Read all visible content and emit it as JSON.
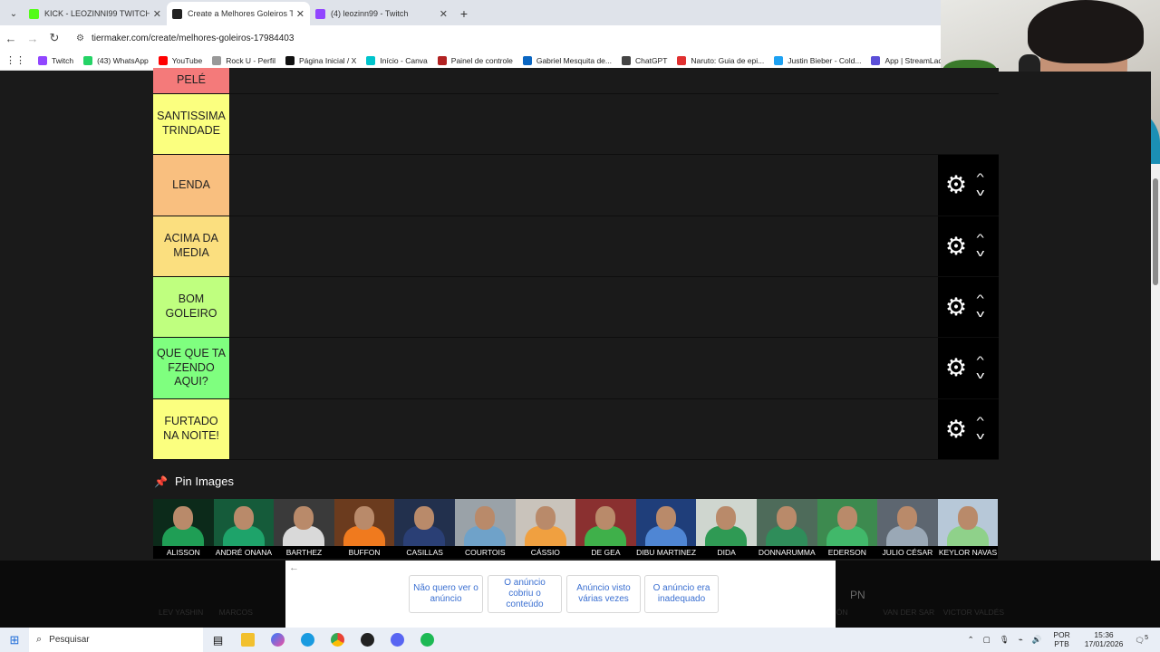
{
  "browser": {
    "tabs": [
      {
        "title": "KICK - LEOZINNI99 TWITCH - LIVE",
        "fav_color": "#53fc18",
        "active": false
      },
      {
        "title": "Create a Melhores Goleiros Tier",
        "fav_color": "#222222",
        "active": true
      },
      {
        "title": "(4) leozinn99 - Twitch",
        "fav_color": "#9146ff",
        "active": false
      }
    ],
    "url": "tiermaker.com/create/melhores-goleiros-17984403",
    "bookmarks": [
      {
        "label": "Twitch",
        "color": "#9146ff"
      },
      {
        "label": "(43) WhatsApp",
        "color": "#25d366"
      },
      {
        "label": "YouTube",
        "color": "#ff0000"
      },
      {
        "label": "Rock U - Perfil",
        "color": "#999999"
      },
      {
        "label": "Página Inicial / X",
        "color": "#111111"
      },
      {
        "label": "Início - Canva",
        "color": "#00c4cc"
      },
      {
        "label": "Painel de controle",
        "color": "#b22222"
      },
      {
        "label": "Gabriel Mesquita de...",
        "color": "#0a66c2"
      },
      {
        "label": "ChatGPT",
        "color": "#444444"
      },
      {
        "label": "Naruto: Guia de epi...",
        "color": "#e03030"
      },
      {
        "label": "Justin Bieber - Cold...",
        "color": "#1da1f2"
      },
      {
        "label": "App | StreamLadder",
        "color": "#5b4fd8"
      },
      {
        "label": "Agend",
        "color": "#2e9e4f"
      }
    ]
  },
  "tiers": [
    {
      "label": "PELÉ",
      "color": "#f47a7a"
    },
    {
      "label": "SANTISSIMA TRINDADE",
      "color": "#fbff7f"
    },
    {
      "label": "LENDA",
      "color": "#f9bf7f"
    },
    {
      "label": "ACIMA DA MEDIA",
      "color": "#fbdf7f"
    },
    {
      "label": "BOM GOLEIRO",
      "color": "#bfff7f"
    },
    {
      "label": "QUE QUE TA FZENDO AQUI?",
      "color": "#7fff7f"
    },
    {
      "label": "FURTADO NA NOITE!",
      "color": "#fbff7f"
    }
  ],
  "pin_images_label": "Pin Images",
  "pool": [
    {
      "name": "ALISSON",
      "kit": "#1f9e55",
      "bg": "#0c2a1a"
    },
    {
      "name": "ANDRÉ ONANA",
      "kit": "#1ea36a",
      "bg": "#155b3a"
    },
    {
      "name": "BARTHEZ",
      "kit": "#d9d9d9",
      "bg": "#3a3a3a"
    },
    {
      "name": "BUFFON",
      "kit": "#f07a1e",
      "bg": "#6b3b1e"
    },
    {
      "name": "CASILLAS",
      "kit": "#2a3f75",
      "bg": "#22304d"
    },
    {
      "name": "COURTOIS",
      "kit": "#6fa2c9",
      "bg": "#9aa2a8"
    },
    {
      "name": "CÁSSIO",
      "kit": "#f0a040",
      "bg": "#c9c3bb"
    },
    {
      "name": "DE GEA",
      "kit": "#3fb04a",
      "bg": "#8a3030"
    },
    {
      "name": "DIBU MARTINEZ",
      "kit": "#4f86d4",
      "bg": "#1f3e7a"
    },
    {
      "name": "DIDA",
      "kit": "#2f9a54",
      "bg": "#cfd6cf"
    },
    {
      "name": "DONNARUMMA",
      "kit": "#2f8d5a",
      "bg": "#4e6b5a"
    },
    {
      "name": "EDERSON",
      "kit": "#41b86a",
      "bg": "#3d8a4f"
    },
    {
      "name": "JULIO CÉSAR",
      "kit": "#9aa8b6",
      "bg": "#5d6670"
    },
    {
      "name": "KEYLOR NAVAS",
      "kit": "#8fd18a",
      "bg": "#b7c8d8"
    }
  ],
  "hidden_row": [
    "LEV YASHIN",
    "MARCOS",
    "",
    "",
    "",
    "",
    "",
    "",
    "",
    "",
    "",
    "SIMÓN",
    "VAN DER SAR",
    "VICTOR VALDÉS"
  ],
  "ad": {
    "options": [
      "Não quero ver o anúncio",
      "O anúncio cobriu o conteúdo",
      "Anúncio visto várias vezes",
      "O anúncio era inadequado"
    ],
    "badge": "PN"
  },
  "taskbar": {
    "search_placeholder": "Pesquisar",
    "lang_top": "POR",
    "lang_bottom": "PTB",
    "time": "15:36",
    "date": "17/01/2026",
    "notification_count": "5"
  }
}
